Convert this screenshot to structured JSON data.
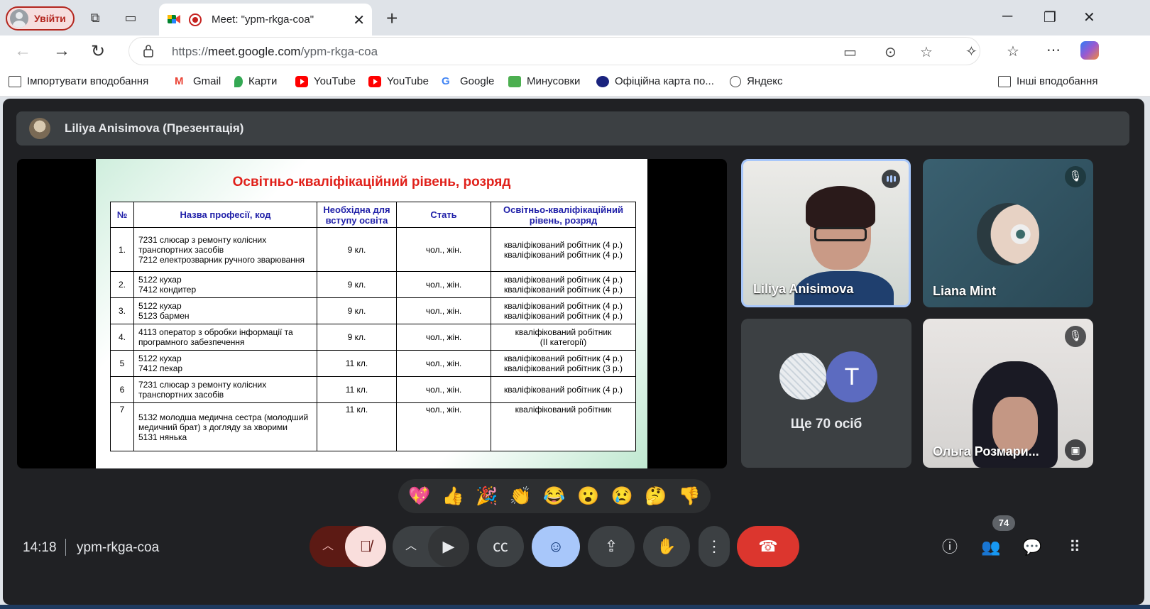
{
  "browser": {
    "profile_label": "Увійти",
    "tab_title": "Meet: \"ypm-rkga-coa\"",
    "url_prefix": "https://",
    "url_domain": "meet.google.com",
    "url_path": "/ypm-rkga-coa"
  },
  "bookmarks": {
    "import": "Імпортувати вподобання",
    "items": [
      "Gmail",
      "Карти",
      "YouTube",
      "YouTube",
      "Google",
      "Минусовки",
      "Офіційна карта по...",
      "Яндекс"
    ],
    "other": "Інші вподобання"
  },
  "meet": {
    "presenter_label": "Liliya Anisimova (Презентація)",
    "slide": {
      "title": "Освітньо-кваліфікаційний рівень, розряд",
      "headers": [
        "№",
        "Назва професії, код",
        "Необхідна для вступу освіта",
        "Стать",
        "Освітньо-кваліфікаційний рівень, розряд"
      ],
      "rows": [
        [
          "1.",
          "7231 слюсар з ремонту колісних транспортних засобів\n7212 електрозварник ручного зварювання",
          "9 кл.",
          "чол., жін.",
          "кваліфікований робітник (4 р.)\nкваліфікований робітник (4 р.)"
        ],
        [
          "2.",
          "5122 кухар\n7412 кондитер",
          "9 кл.",
          "чол., жін.",
          "кваліфікований робітник (4 р.)\nкваліфікований робітник (4 р.)"
        ],
        [
          "3.",
          "5122 кухар\n5123 бармен",
          "9 кл.",
          "чол., жін.",
          "кваліфікований робітник (4 р.)\nкваліфікований робітник (4 р.)"
        ],
        [
          "4.",
          "4113 оператор з обробки інформації та програмного забезпечення",
          "9 кл.",
          "чол., жін.",
          "кваліфікований робітник\n(ІІ категорії)"
        ],
        [
          "5",
          "5122 кухар\n7412 пекар",
          "11 кл.",
          "чол., жін.",
          "кваліфікований робітник (4 р.)\nкваліфікований робітник (3 р.)"
        ],
        [
          "6",
          "7231 слюсар з ремонту колісних транспортних засобів",
          "11 кл.",
          "чол., жін.",
          "кваліфікований робітник (4 р.)"
        ],
        [
          "7",
          "5132 молодша медична сестра (молодший медичний брат) з догляду за хворими\n5131 нянька",
          "11 кл.",
          "чол., жін.",
          "кваліфікований робітник"
        ]
      ]
    },
    "participants": {
      "p1": "Liliya Anisimova",
      "p2": "Liana Mint",
      "more_initial": "T",
      "more_label": "Ще 70 осіб",
      "p4": "Ольга Розмари..."
    },
    "reactions": [
      "💖",
      "👍",
      "🎉",
      "👏",
      "😂",
      "😮",
      "😢",
      "🤔",
      "👎"
    ],
    "bottom": {
      "time": "14:18",
      "meeting_code": "ypm-rkga-coa",
      "participant_count": "74"
    }
  }
}
